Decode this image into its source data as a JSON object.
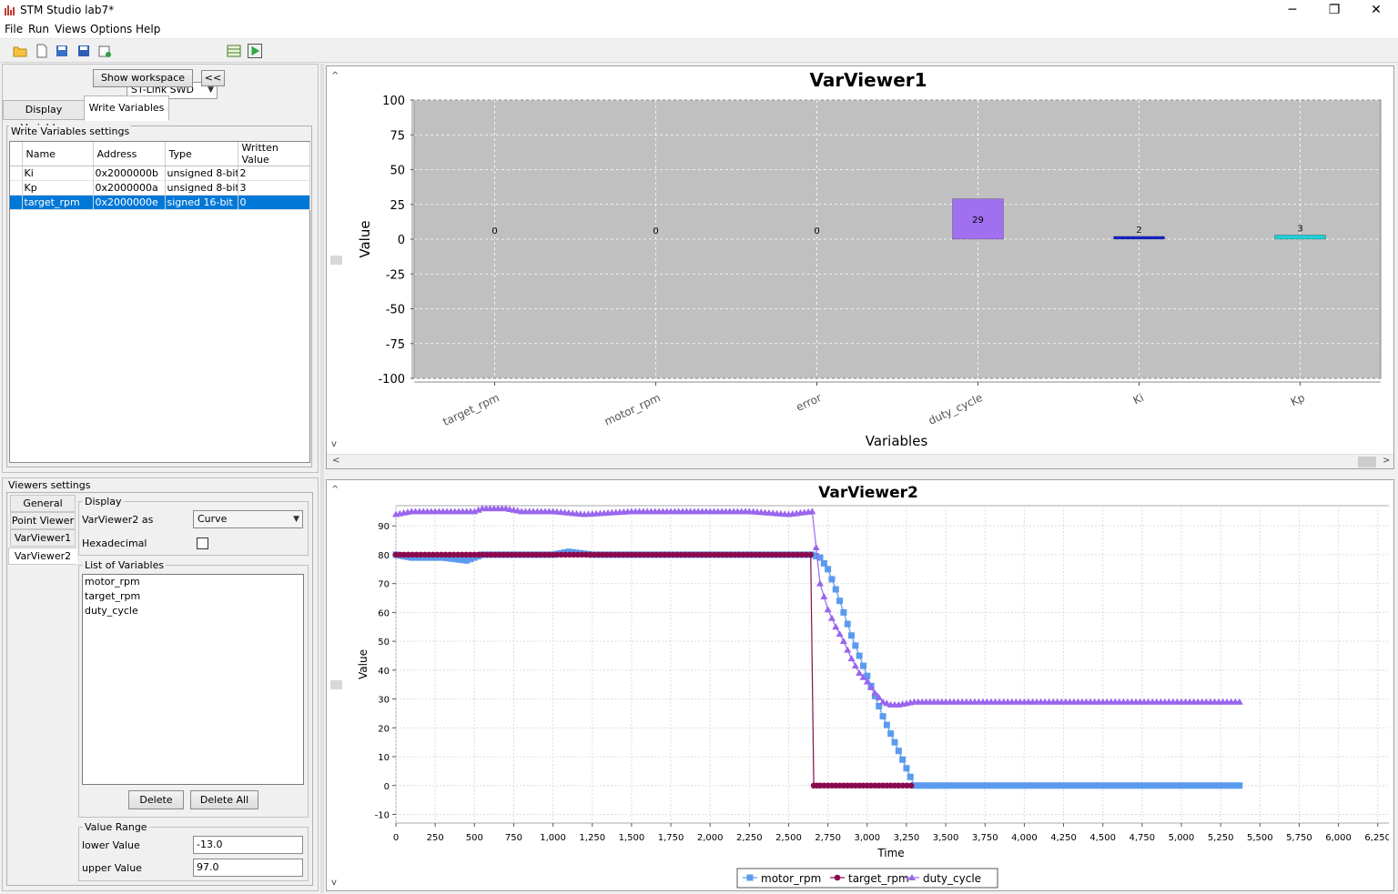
{
  "window": {
    "title": "STM Studio lab7*",
    "minimize": "─",
    "maximize": "❐",
    "close": "✕"
  },
  "menu": [
    "File",
    "Run",
    "Views",
    "Options",
    "Help"
  ],
  "toolbar": {
    "connection": "ST-Link SWD"
  },
  "left": {
    "show_workspace": "Show workspace",
    "collapse": "<<",
    "tabs": [
      "Display Variables",
      "Write Variables"
    ],
    "active_tab": "Write Variables",
    "write_settings_title": "Write Variables settings",
    "columns": [
      "Name",
      "Address",
      "Type",
      "Written Value"
    ],
    "rows": [
      {
        "name": "Ki",
        "address": "0x2000000b",
        "type": "unsigned 8-bit",
        "value": "2"
      },
      {
        "name": "Kp",
        "address": "0x2000000a",
        "type": "unsigned 8-bit",
        "value": "3"
      },
      {
        "name": "target_rpm",
        "address": "0x2000000e",
        "type": "signed 16-bit",
        "value": "0"
      }
    ],
    "viewers_settings_title": "Viewers settings",
    "viewer_tabs": [
      "General",
      "Point Viewer",
      "VarViewer1",
      "VarViewer2"
    ],
    "active_viewer_tab": "VarViewer2",
    "display_title": "Display",
    "display_as_label": "VarViewer2 as",
    "display_as_value": "Curve",
    "hex_label": "Hexadecimal",
    "list_title": "List of Variables",
    "list_vars": [
      "motor_rpm",
      "target_rpm",
      "duty_cycle"
    ],
    "delete_button": "Delete",
    "delete_all_button": "Delete All",
    "value_range_title": "Value Range",
    "lower_label": "lower Value",
    "lower_value": "-13.0",
    "upper_label": "upper Value",
    "upper_value": "97.0"
  },
  "chart_data": [
    {
      "type": "bar",
      "title": "VarViewer1",
      "xlabel": "Variables",
      "ylabel": "Value",
      "ylim": [
        -100,
        100
      ],
      "yticks": [
        100,
        75,
        50,
        25,
        0,
        -25,
        -50,
        -75,
        -100
      ],
      "categories": [
        "target_rpm",
        "motor_rpm",
        "error",
        "duty_cycle",
        "Ki",
        "Kp"
      ],
      "values": [
        0,
        0,
        0,
        29,
        2,
        3
      ],
      "value_labels": [
        "0",
        "0",
        "0",
        "29",
        "2",
        "3"
      ],
      "colors": [
        "#cc00cc",
        "#a0a0ff",
        "#ff8080",
        "#a070f0",
        "#1020d0",
        "#20d0d8"
      ],
      "grid": true
    },
    {
      "type": "line",
      "title": "VarViewer2",
      "xlabel": "Time",
      "ylabel": "Value",
      "xlim": [
        0,
        6350
      ],
      "ylim": [
        -13,
        97
      ],
      "xticks": [
        "0",
        "250",
        "500",
        "750",
        "1,000",
        "1,250",
        "1,500",
        "1,750",
        "2,000",
        "2,250",
        "2,500",
        "2,750",
        "3,000",
        "3,250",
        "3,500",
        "3,750",
        "4,000",
        "4,250",
        "4,500",
        "4,750",
        "5,000",
        "5,250",
        "5,500",
        "5,750",
        "6,000",
        "6,250"
      ],
      "yticks": [
        90,
        80,
        70,
        60,
        50,
        40,
        30,
        20,
        10,
        0,
        -10
      ],
      "grid": true,
      "legend": "bottom",
      "series": [
        {
          "name": "motor_rpm",
          "color": "#5b9bef",
          "marker": "square",
          "x": [
            0,
            100,
            300,
            450,
            500,
            550,
            700,
            900,
            1000,
            1100,
            1250,
            1500,
            1750,
            2000,
            2250,
            2500,
            2650,
            2700,
            2750,
            2800,
            2850,
            2900,
            2950,
            3000,
            3050,
            3100,
            3150,
            3200,
            3250,
            3300,
            3500,
            4000,
            4500,
            5000,
            5370
          ],
          "y": [
            80,
            79,
            79,
            78,
            79,
            80,
            80,
            80,
            80,
            81,
            80,
            80,
            80,
            80,
            80,
            80,
            80,
            79,
            75,
            68,
            60,
            52,
            45,
            38,
            31,
            24,
            18,
            12,
            6,
            0,
            0,
            0,
            0,
            0,
            0
          ]
        },
        {
          "name": "target_rpm",
          "color": "#8b0a4e",
          "marker": "circle",
          "x": [
            0,
            500,
            1000,
            1500,
            2000,
            2500,
            2640,
            2660,
            2700,
            2800,
            2900,
            3000,
            3100,
            3200,
            3280
          ],
          "y": [
            80,
            80,
            80,
            80,
            80,
            80,
            80,
            0,
            0,
            0,
            0,
            0,
            0,
            0,
            0
          ]
        },
        {
          "name": "duty_cycle",
          "color": "#9966ee",
          "marker": "triangle",
          "x": [
            0,
            100,
            300,
            500,
            550,
            700,
            800,
            1000,
            1200,
            1500,
            1750,
            2000,
            2250,
            2500,
            2650,
            2700,
            2750,
            2800,
            2850,
            2900,
            2950,
            3000,
            3050,
            3100,
            3150,
            3200,
            3300,
            3500,
            4000,
            4500,
            5000,
            5370
          ],
          "y": [
            94,
            95,
            95,
            95,
            96,
            96,
            95,
            95,
            94,
            95,
            95,
            95,
            95,
            94,
            95,
            70,
            61,
            55,
            50,
            44,
            39,
            36,
            32,
            29,
            28,
            28,
            29,
            29,
            29,
            29,
            29,
            29
          ]
        }
      ]
    }
  ]
}
